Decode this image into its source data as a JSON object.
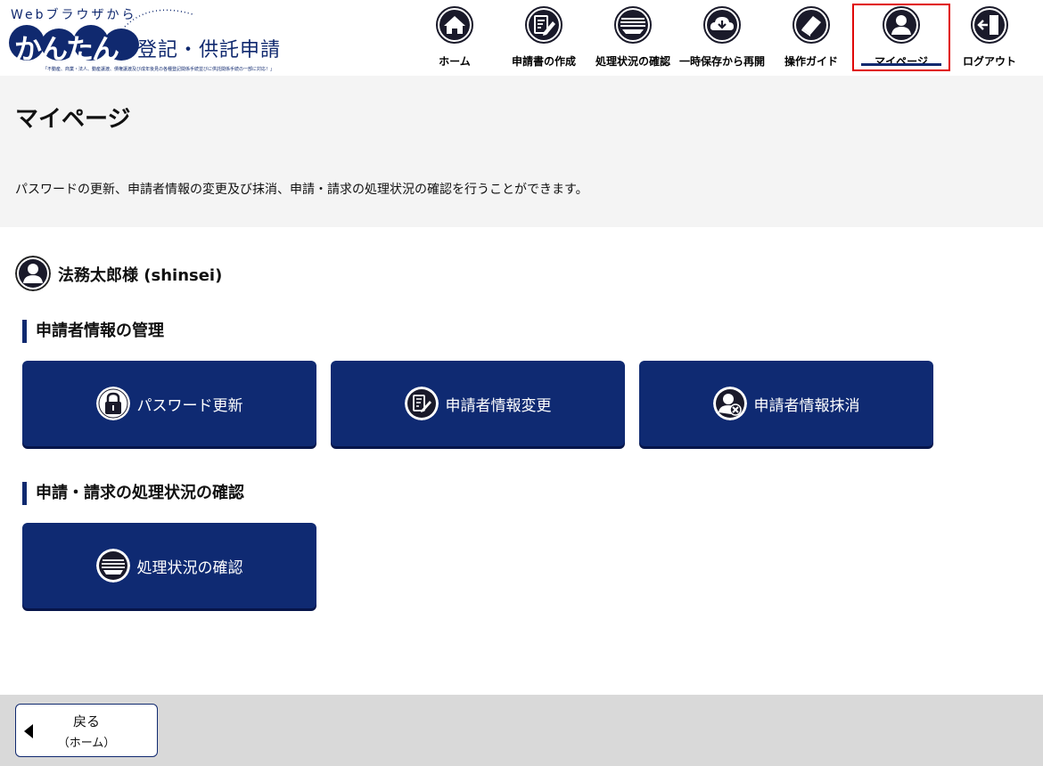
{
  "logo": {
    "web_text": "Webブラウザから",
    "kantan": "かんたん",
    "title": "登記・供託申請",
    "subtext": "「不動産、商業・法人、動産譲渡、債権譲渡及び成年後見の各種登記関係手続並びに供託関係手続の一部に対応！」"
  },
  "nav": {
    "items": [
      {
        "label": "ホーム",
        "icon": "home-icon"
      },
      {
        "label": "申請書の作成",
        "icon": "edit-document-icon"
      },
      {
        "label": "処理状況の確認",
        "icon": "status-icon"
      },
      {
        "label": "一時保存から再開",
        "icon": "cloud-download-icon"
      },
      {
        "label": "操作ガイド",
        "icon": "guide-book-icon"
      },
      {
        "label": "マイページ",
        "icon": "user-icon"
      },
      {
        "label": "ログアウト",
        "icon": "logout-icon"
      }
    ],
    "active_index": 5
  },
  "page": {
    "title": "マイページ",
    "description": "パスワードの更新、申請者情報の変更及び抹消、申請・請求の処理状況の確認を行うことができます。"
  },
  "user": {
    "name": "法務太郎様 (shinsei)"
  },
  "sections": {
    "applicant": {
      "title": "申請者情報の管理",
      "buttons": [
        {
          "label": "パスワード更新",
          "icon": "lock-icon"
        },
        {
          "label": "申請者情報変更",
          "icon": "edit-document-icon"
        },
        {
          "label": "申請者情報抹消",
          "icon": "user-delete-icon"
        }
      ]
    },
    "status": {
      "title": "申請・請求の処理状況の確認",
      "buttons": [
        {
          "label": "処理状況の確認",
          "icon": "status-icon"
        }
      ]
    }
  },
  "footer": {
    "back_line1": "戻る",
    "back_line2": "（ホーム）"
  },
  "colors": {
    "primary": "#0f2a72",
    "active_border": "#e00000",
    "page_head_bg": "#f4f4f4",
    "footer_bg": "#d9d9d9"
  }
}
